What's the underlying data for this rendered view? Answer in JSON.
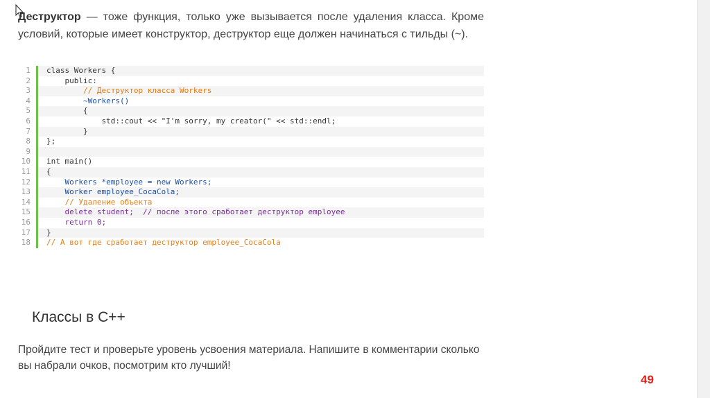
{
  "intro": {
    "term": "Деструктор",
    "text": " — тоже функция, только уже вызывается после удаления класса. Кроме условий, которые имеет конструктор, деструктор еще должен начинаться с тильды (~)."
  },
  "code": {
    "line_numbers": [
      "1",
      "2",
      "3",
      "4",
      "5",
      "6",
      "7",
      "8",
      "9",
      "10",
      "11",
      "12",
      "13",
      "14",
      "15",
      "16",
      "17",
      "18"
    ],
    "lines": [
      "class Workers {",
      "    public:",
      "        // Деструктор класса Workers",
      "        ~Workers()",
      "        {",
      "            std::cout << \"I'm sorry, my creator(\" << std::endl;",
      "        }",
      "};",
      "",
      "int main()",
      "{",
      "    Workers *employee = new Workers;",
      "    Worker employee_CocaCola;",
      "    // Удаление объекта",
      "    delete student;  // после этого сработает деструктор employee",
      "    return 0;",
      "}",
      "// А вот где сработает деструктор employee_CocaCola"
    ]
  },
  "section": {
    "title": "Классы в C++"
  },
  "outro": {
    "text": "Пройдите тест и проверьте уровень усвоения материала. Напишите в комментарии сколько вы набрали очков, посмотрим кто лучший!"
  },
  "page_number": "49",
  "colors": {
    "accent_green": "#6cc04a",
    "page_number": "#e0221a",
    "comment": "#e77b0e",
    "keyword": "#7a2a9a"
  }
}
